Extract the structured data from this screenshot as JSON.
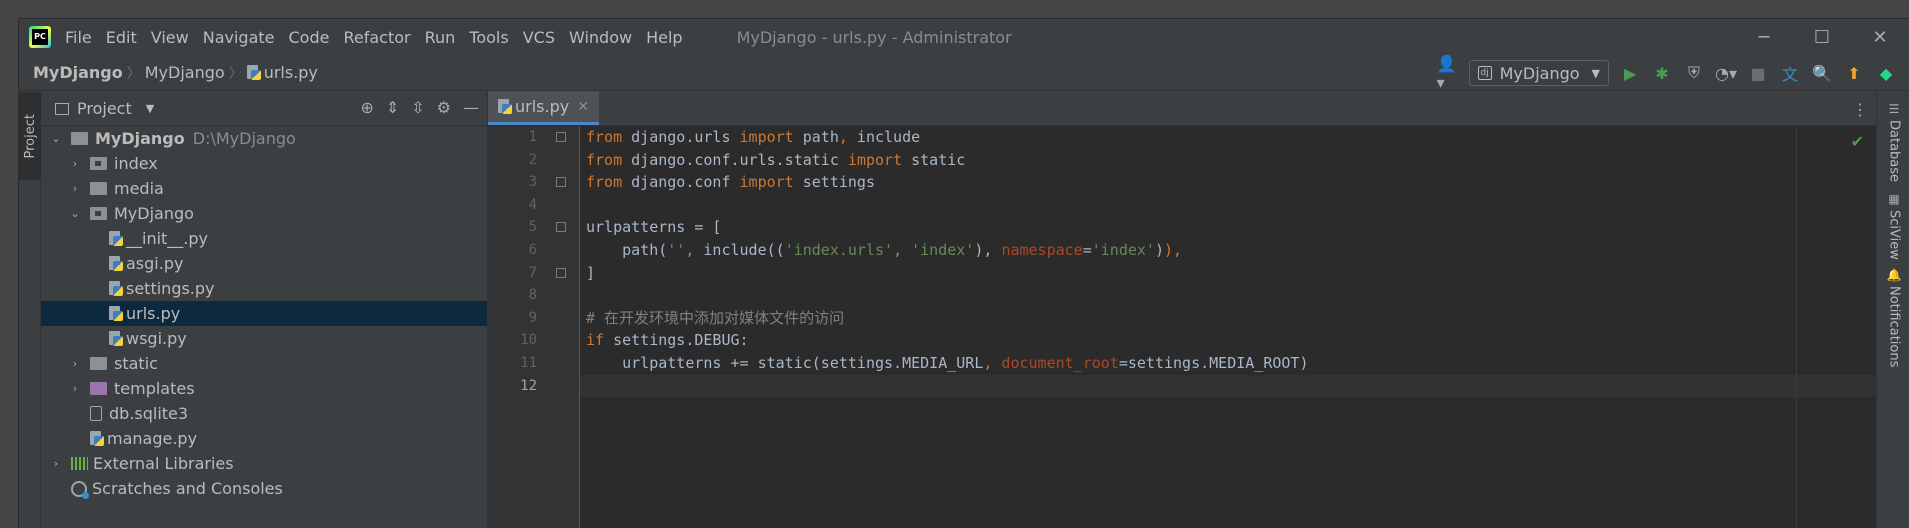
{
  "titlebar": {
    "menu": [
      "File",
      "Edit",
      "View",
      "Navigate",
      "Code",
      "Refactor",
      "Run",
      "Tools",
      "VCS",
      "Window",
      "Help"
    ],
    "window_title": "MyDjango - urls.py - Administrator",
    "controls": [
      "─",
      "☐",
      "✕"
    ]
  },
  "navbar": {
    "breadcrumbs": [
      "MyDjango",
      "MyDjango",
      "urls.py"
    ],
    "run_config": "MyDjango"
  },
  "left_stripe": {
    "project_tab": "Project"
  },
  "project_panel": {
    "title": "Project",
    "tree": [
      {
        "label": "MyDjango",
        "path": "D:\\MyDjango",
        "level": 0,
        "arrow": "⌄",
        "icon": "folder"
      },
      {
        "label": "index",
        "level": 1,
        "arrow": "›",
        "icon": "package"
      },
      {
        "label": "media",
        "level": 1,
        "arrow": "›",
        "icon": "folder"
      },
      {
        "label": "MyDjango",
        "level": 1,
        "arrow": "⌄",
        "icon": "package"
      },
      {
        "label": "__init__.py",
        "level": 2,
        "arrow": "",
        "icon": "python-file"
      },
      {
        "label": "asgi.py",
        "level": 2,
        "arrow": "",
        "icon": "python-file"
      },
      {
        "label": "settings.py",
        "level": 2,
        "arrow": "",
        "icon": "python-file"
      },
      {
        "label": "urls.py",
        "level": 2,
        "arrow": "",
        "icon": "python-file",
        "selected": true
      },
      {
        "label": "wsgi.py",
        "level": 2,
        "arrow": "",
        "icon": "python-file"
      },
      {
        "label": "static",
        "level": 1,
        "arrow": "›",
        "icon": "folder"
      },
      {
        "label": "templates",
        "level": 1,
        "arrow": "›",
        "icon": "folder-purple"
      },
      {
        "label": "db.sqlite3",
        "level": 1,
        "arrow": "",
        "icon": "database-file"
      },
      {
        "label": "manage.py",
        "level": 1,
        "arrow": "",
        "icon": "python-file"
      },
      {
        "label": "External Libraries",
        "level": 0,
        "arrow": "›",
        "icon": "library"
      },
      {
        "label": "Scratches and Consoles",
        "level": 0,
        "arrow": "",
        "icon": "scratch"
      }
    ]
  },
  "editor": {
    "tab_label": "urls.py",
    "tab_close": "✕",
    "current_line": 12,
    "lines": [
      [
        [
          "kw",
          "from"
        ],
        [
          "",
          " django.urls "
        ],
        [
          "kw",
          "import"
        ],
        [
          "",
          " path"
        ],
        [
          "kw",
          ","
        ],
        [
          "",
          " include"
        ]
      ],
      [
        [
          "kw",
          "from"
        ],
        [
          "",
          " django.conf.urls.static "
        ],
        [
          "kw",
          "import"
        ],
        [
          "",
          " static"
        ]
      ],
      [
        [
          "kw",
          "from"
        ],
        [
          "",
          " django.conf "
        ],
        [
          "kw",
          "import"
        ],
        [
          "",
          " settings"
        ]
      ],
      [],
      [
        [
          "",
          "urlpatterns = ["
        ]
      ],
      [
        [
          "",
          "    path("
        ],
        [
          "str",
          "''"
        ],
        [
          "kw",
          ","
        ],
        [
          "",
          " include(("
        ],
        [
          "str",
          "'index.urls'"
        ],
        [
          "kw",
          ","
        ],
        [
          "",
          " "
        ],
        [
          "str",
          "'index'"
        ],
        [
          "",
          "), "
        ],
        [
          "param",
          "namespace"
        ],
        [
          "",
          "="
        ],
        [
          "str",
          "'index'"
        ],
        [
          "",
          ")"
        ],
        [
          "kw",
          ")"
        ],
        [
          "kw",
          ","
        ]
      ],
      [
        [
          "",
          "]"
        ]
      ],
      [],
      [
        [
          "cmt",
          "# 在开发环境中添加对媒体文件的访问"
        ]
      ],
      [
        [
          "kw",
          "if"
        ],
        [
          "",
          " settings.DEBUG:"
        ]
      ],
      [
        [
          "",
          "    urlpatterns += static(settings.MEDIA_URL"
        ],
        [
          "kw",
          ","
        ],
        [
          "",
          " "
        ],
        [
          "param",
          "document_root"
        ],
        [
          "",
          "=settings.MEDIA_ROOT)"
        ]
      ],
      []
    ]
  },
  "right_stripe": [
    "Database",
    "SciView",
    "Notifications"
  ]
}
